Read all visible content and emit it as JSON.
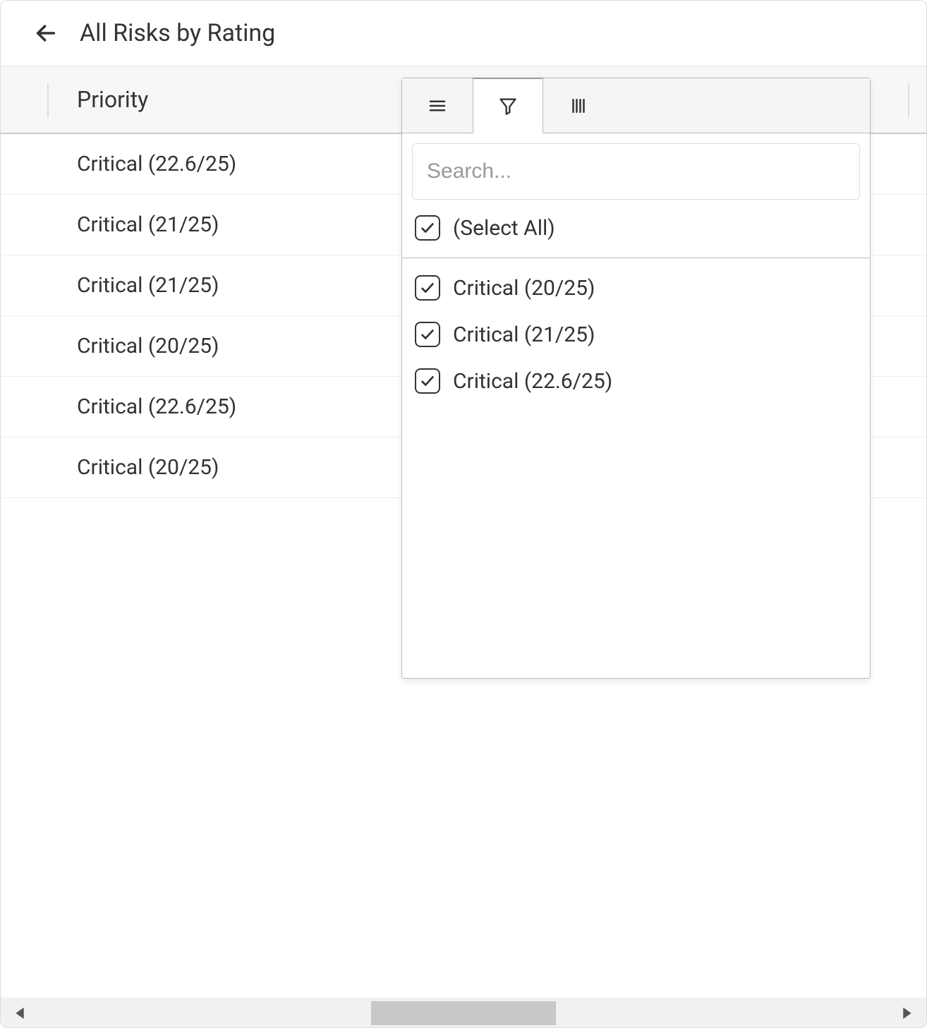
{
  "header": {
    "title": "All Risks by Rating"
  },
  "grid": {
    "column_header": "Priority",
    "rows": [
      {
        "priority": "Critical (22.6/25)"
      },
      {
        "priority": "Critical (21/25)"
      },
      {
        "priority": "Critical (21/25)"
      },
      {
        "priority": "Critical (20/25)"
      },
      {
        "priority": "Critical (22.6/25)"
      },
      {
        "priority": "Critical (20/25)"
      }
    ]
  },
  "filter_popup": {
    "active_tab": "filter",
    "search_placeholder": "Search...",
    "select_all_label": "(Select All)",
    "select_all_checked": true,
    "items": [
      {
        "label": "Critical (20/25)",
        "checked": true
      },
      {
        "label": "Critical (21/25)",
        "checked": true
      },
      {
        "label": "Critical (22.6/25)",
        "checked": true
      }
    ]
  }
}
